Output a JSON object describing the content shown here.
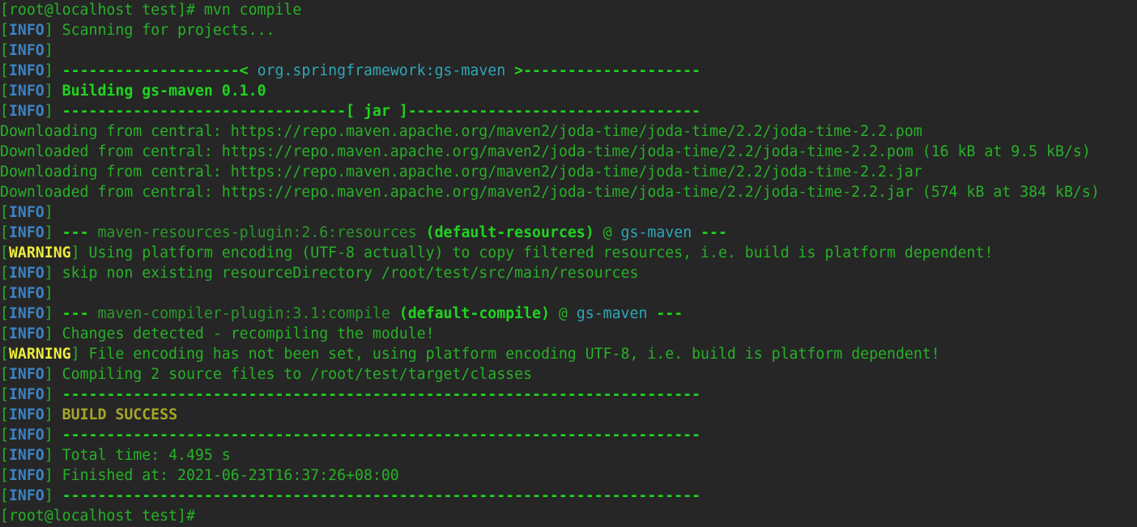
{
  "colors": {
    "background": "#262626",
    "text_green": "#27b127",
    "bold_green": "#1fd41f",
    "info_blue": "#3b82c4",
    "cyan": "#2fa7b8",
    "warning_yellow": "#ecec3c",
    "success_olive": "#a6a62a"
  },
  "terminal": {
    "prompt": "[root@localhost test]#",
    "command": " mvn compile",
    "final_prompt": "[root@localhost test]#",
    "tag_info": "INFO",
    "tag_warning": "WARNING",
    "bracket_open": "[",
    "bracket_close": "]",
    "scanning": " Scanning for projects...",
    "dash_left": " --------------------< ",
    "artifact": "org.springframework:gs-maven",
    "dash_right": " >--------------------",
    "building": "Building gs-maven 0.1.0",
    "packaging_left": " --------------------------------[ ",
    "packaging": "jar",
    "packaging_right": " ]---------------------------------",
    "downloads": [
      "Downloading from central: https://repo.maven.apache.org/maven2/joda-time/joda-time/2.2/joda-time-2.2.pom",
      "Downloaded from central: https://repo.maven.apache.org/maven2/joda-time/joda-time/2.2/joda-time-2.2.pom (16 kB at 9.5 kB/s)",
      "Downloading from central: https://repo.maven.apache.org/maven2/joda-time/joda-time/2.2/joda-time-2.2.jar",
      "Downloaded from central: https://repo.maven.apache.org/maven2/joda-time/joda-time/2.2/joda-time-2.2.jar (574 kB at 384 kB/s)"
    ],
    "triple_dash": "---",
    "resources_plugin": "maven-resources-plugin:2.6:resources",
    "resources_exec": "(default-resources)",
    "at_sign": "@",
    "project": "gs-maven",
    "warning_resources": " Using platform encoding (UTF-8 actually) to copy filtered resources, i.e. build is platform dependent!",
    "skip_resources": " skip non existing resourceDirectory /root/test/src/main/resources",
    "compiler_plugin": "maven-compiler-plugin:3.1:compile",
    "compiler_exec": "(default-compile)",
    "changes_detected": " Changes detected - recompiling the module!",
    "warning_encoding": " File encoding has not been set, using platform encoding UTF-8, i.e. build is platform dependent!",
    "compiling": " Compiling 2 source files to /root/test/target/classes",
    "separator": " ------------------------------------------------------------------------",
    "build_success": "BUILD SUCCESS",
    "total_time": " Total time: 4.495 s",
    "finished_at": " Finished at: 2021-06-23T16:37:26+08:00"
  }
}
